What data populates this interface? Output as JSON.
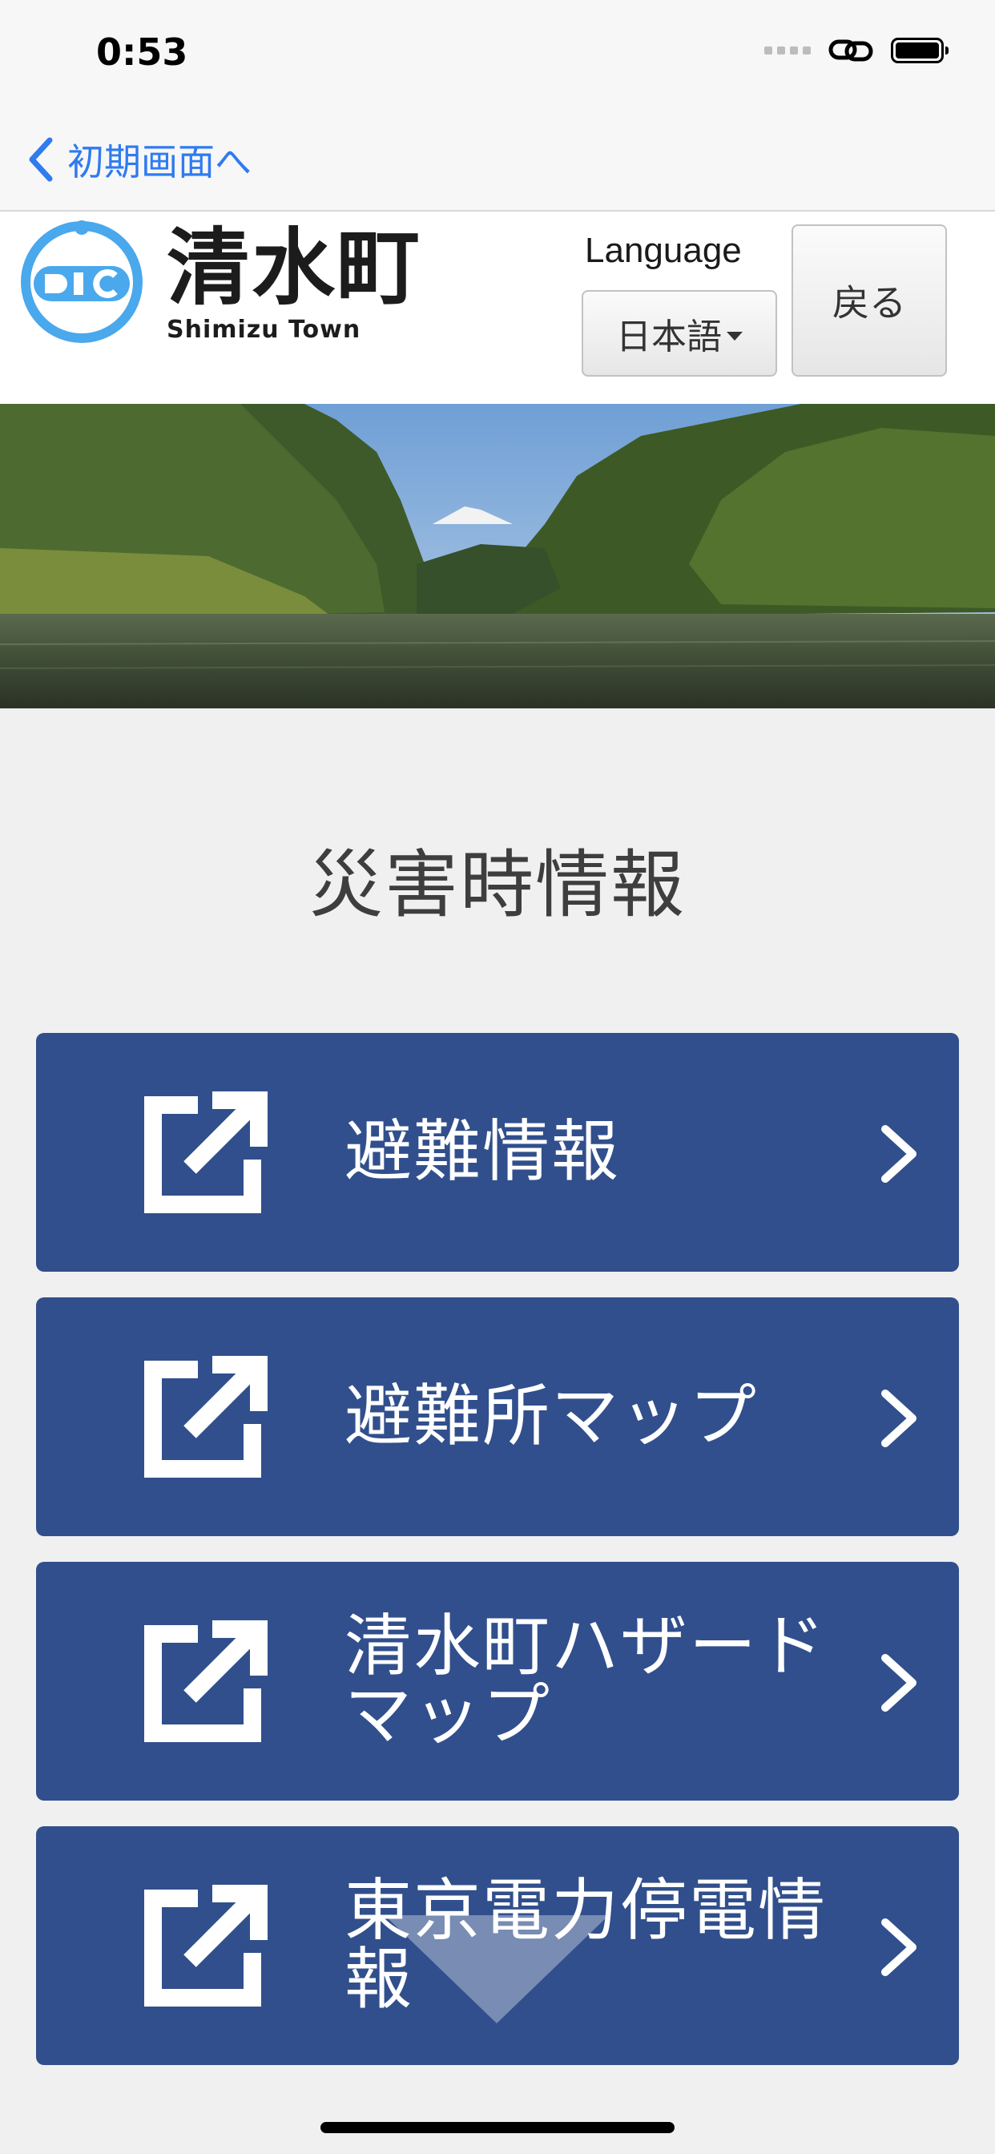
{
  "status_bar": {
    "time": "0:53",
    "icons": [
      "signal-dots-icon",
      "link-icon",
      "battery-icon"
    ]
  },
  "nav": {
    "back_label": "初期画面へ"
  },
  "header": {
    "logo_kanji": "清水町",
    "logo_romaji": "Shimizu Town",
    "language_label": "Language",
    "language_selected": "日本語",
    "back_button": "戻る"
  },
  "page": {
    "title": "災害時情報"
  },
  "menu": {
    "items": [
      {
        "label": "避難情報",
        "icon": "external-link-icon"
      },
      {
        "label": "避難所マップ",
        "icon": "external-link-icon"
      },
      {
        "label": "清水町ハザードマップ",
        "icon": "external-link-icon"
      },
      {
        "label": "東京電力停電情報",
        "icon": "external-link-icon"
      }
    ]
  },
  "colors": {
    "accent_blue": "#2f7bf0",
    "menu_bg": "#314f8c",
    "logo_blue": "#4aa8ec",
    "page_bg": "#f0f0f0"
  }
}
